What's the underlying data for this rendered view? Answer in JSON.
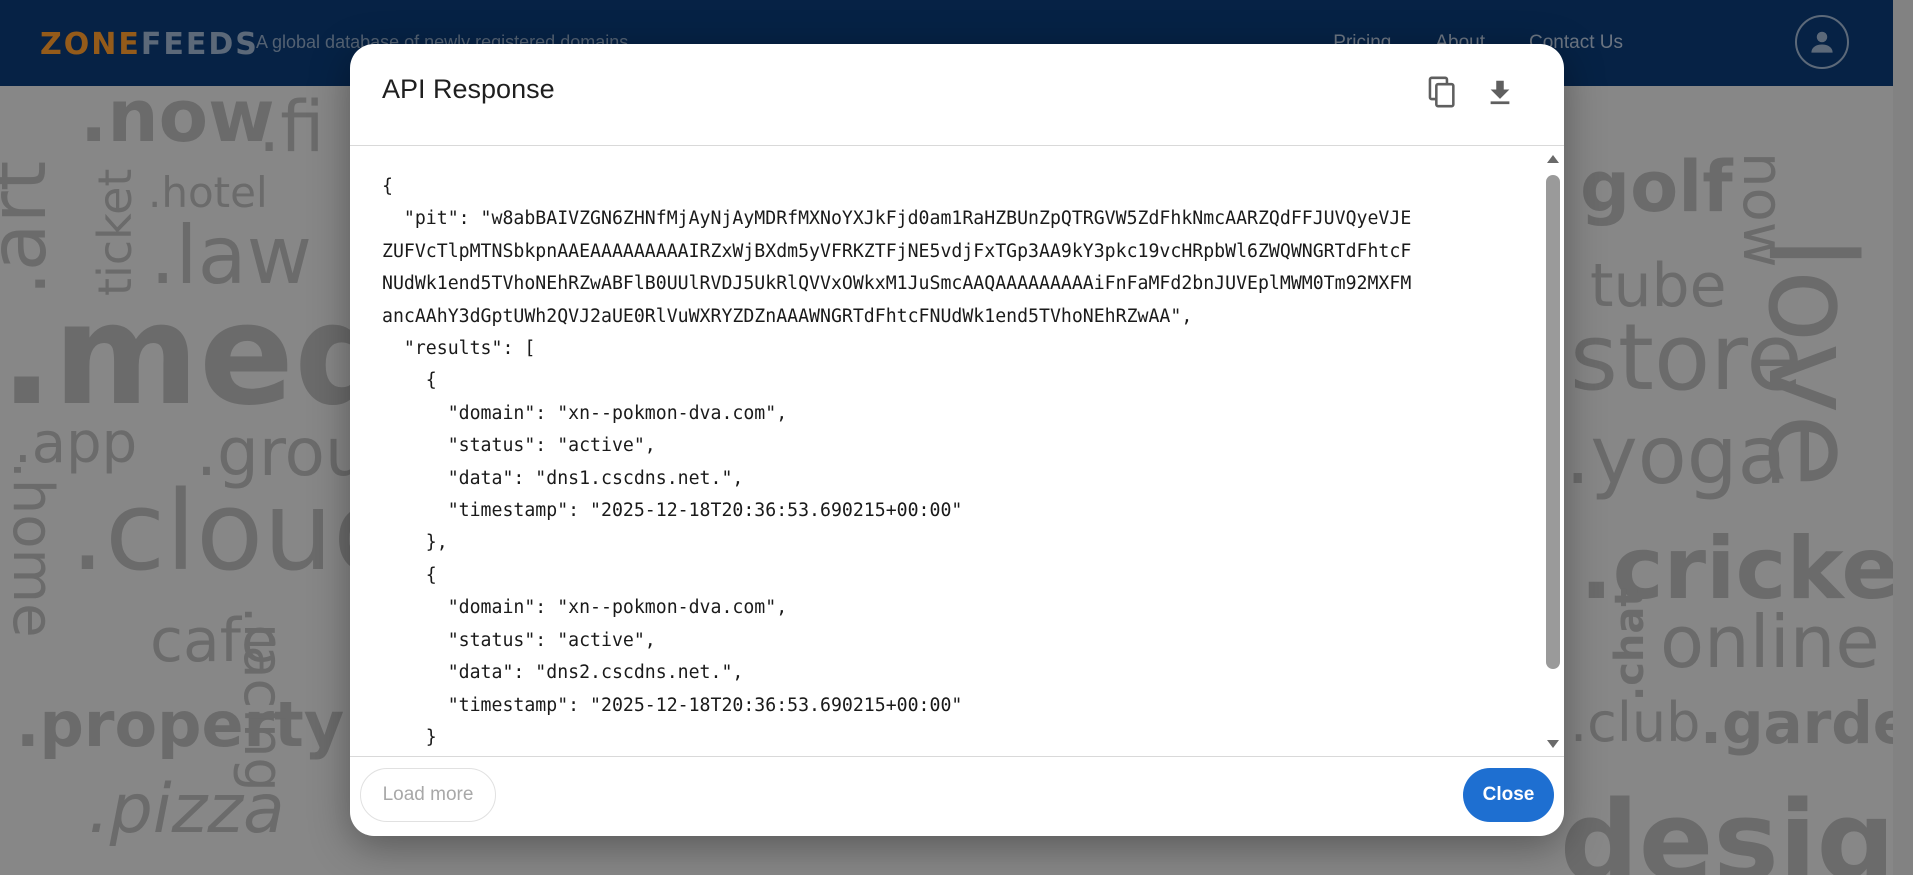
{
  "header": {
    "brand_a": "ZONE",
    "brand_b": "FEEDS",
    "tagline": "A global database of newly registered domains",
    "nav": [
      "Pricing",
      "About",
      "Contact Us"
    ]
  },
  "background": {
    "words": [
      ".art",
      ".now",
      ".fi",
      "ticket",
      ".hotel",
      ".law",
      ".med",
      ".app",
      ".grou",
      ".cloud",
      ".home",
      "cafe",
      ".property",
      ".pizza",
      ".racing",
      "golf",
      "store",
      "now",
      "tube",
      ".yoga",
      "love",
      ".cricket",
      ".chat",
      "online",
      ".club",
      ".garden",
      "design"
    ]
  },
  "modal": {
    "title": "API Response",
    "copy_icon": "copy-icon",
    "download_icon": "download-icon",
    "json_text": "{\n  \"pit\": \"w8abBAIVZGN6ZHNfMjAyNjAyMDRfMXNoYXJkFjd0am1RaHZBUnZpQTRGVW5ZdFhkNmcAARZQdFFJUVQyeVJE\nZUFVcTlpMTNSbkpnAAEAAAAAAAAAIRZxWjBXdm5yVFRKZTFjNE5vdjFxTGp3AA9kY3pkc19vcHRpbWl6ZWQWNGRTdFhtcF\nNUdWk1end5TVhoNEhRZwABFlB0UUlRVDJ5UkRlQVVxOWkxM1JuSmcAAQAAAAAAAAAiFnFaMFd2bnJUVEplMWM0Tm92MXFM\nancAAhY3dGptUWh2QVJ2aUE0RlVuWXRYZDZnAAAWNGRTdFhtcFNUdWk1end5TVhoNEhRZwAA\",\n  \"results\": [\n    {\n      \"domain\": \"xn--pokmon-dva.com\",\n      \"status\": \"active\",\n      \"data\": \"dns1.cscdns.net.\",\n      \"timestamp\": \"2025-12-18T20:36:53.690215+00:00\"\n    },\n    {\n      \"domain\": \"xn--pokmon-dva.com\",\n      \"status\": \"active\",\n      \"data\": \"dns2.cscdns.net.\",\n      \"timestamp\": \"2025-12-18T20:36:53.690215+00:00\"\n    }",
    "load_more_label": "Load more",
    "close_label": "Close"
  },
  "colors": {
    "header_bg": "#0b3b77",
    "brand_orange": "#ff9d2d",
    "primary_button": "#1e6fd1"
  }
}
